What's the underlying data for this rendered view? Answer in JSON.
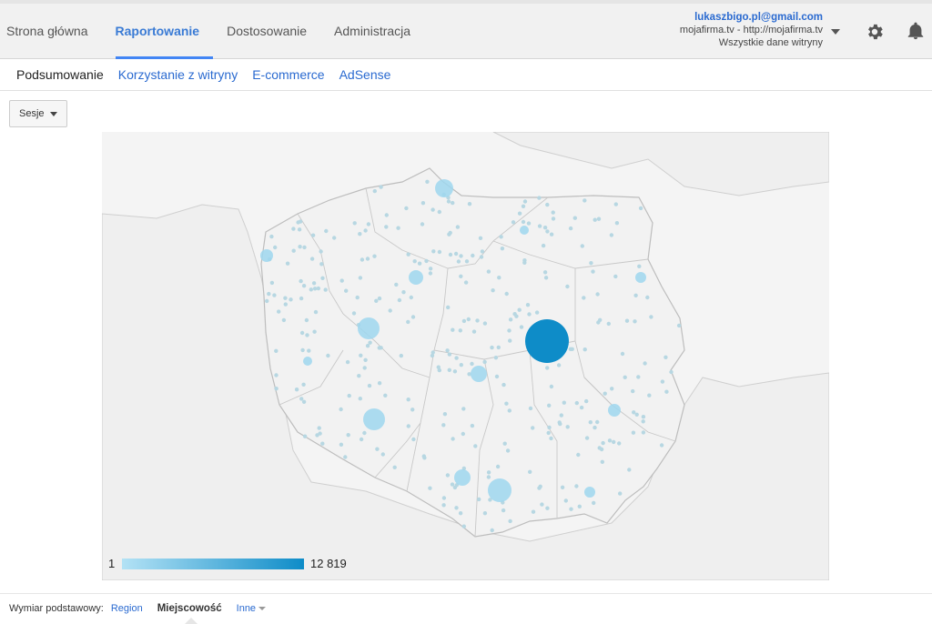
{
  "header": {
    "tabs": [
      {
        "label": "Strona główna",
        "active": false
      },
      {
        "label": "Raportowanie",
        "active": true
      },
      {
        "label": "Dostosowanie",
        "active": false
      },
      {
        "label": "Administracja",
        "active": false
      }
    ],
    "account": {
      "email": "lukaszbigo.pl@gmail.com",
      "property": "mojafirma.tv - http://mojafirma.tv",
      "view": "Wszystkie dane witryny"
    },
    "icons": {
      "account_dropdown": "chevron-down-icon",
      "settings": "gear-icon",
      "notifications": "bell-icon"
    }
  },
  "subnav": {
    "items": [
      {
        "label": "Podsumowanie",
        "active": true
      },
      {
        "label": "Korzystanie z witryny",
        "active": false
      },
      {
        "label": "E-commerce",
        "active": false
      },
      {
        "label": "AdSense",
        "active": false
      }
    ]
  },
  "metric_selector": {
    "selected": "Sesje"
  },
  "map": {
    "region": "Polska",
    "legend": {
      "min": "1",
      "max": "12 819",
      "color_low": "#b3e2f5",
      "color_high": "#0e8cc8"
    },
    "colors": {
      "land": "#f2f2f2",
      "water": "#f4f4f4",
      "border": "#c8c8c8",
      "bubble": "#9fd7ef",
      "bubble_max": "#0e8cc8",
      "dot": "#b7d7e2"
    }
  },
  "dimension_bar": {
    "label": "Wymiar podstawowy:",
    "region_link": "Region",
    "current": "Miejscowość",
    "other": "Inne"
  }
}
